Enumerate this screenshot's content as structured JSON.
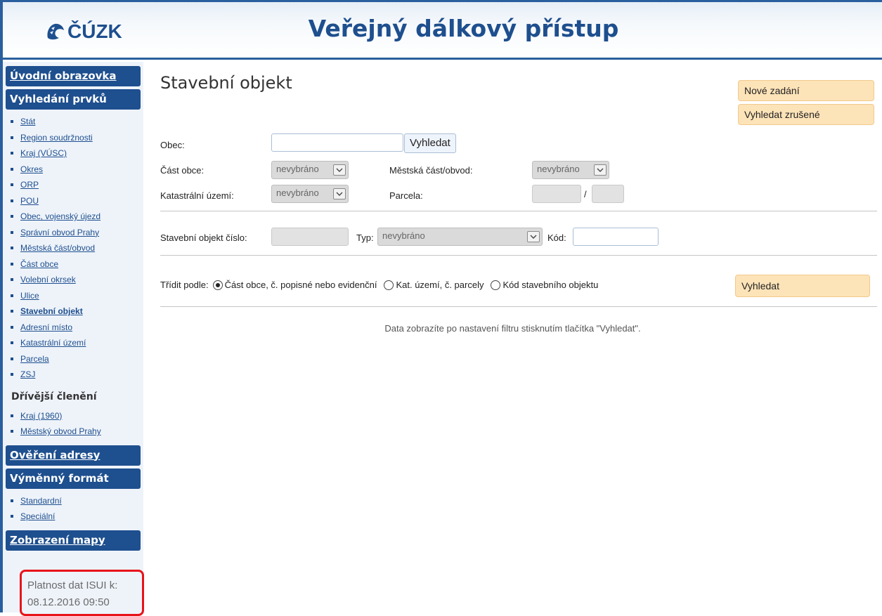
{
  "header": {
    "logo_text": "ČÚZK",
    "title": "Veřejný dálkový přístup"
  },
  "sidebar": {
    "home": "Úvodní obrazovka",
    "search_head": "Vyhledání prvků",
    "search_items": [
      {
        "label": "Stát"
      },
      {
        "label": "Region soudržnosti"
      },
      {
        "label": "Kraj (VÚSC)"
      },
      {
        "label": "Okres"
      },
      {
        "label": "ORP"
      },
      {
        "label": "POU"
      },
      {
        "label": "Obec, vojenský újezd"
      },
      {
        "label": "Správní obvod Prahy"
      },
      {
        "label": "Městská část/obvod"
      },
      {
        "label": "Část obce"
      },
      {
        "label": "Volební okrsek"
      },
      {
        "label": "Ulice"
      },
      {
        "label": "Stavební objekt"
      },
      {
        "label": "Adresní místo"
      },
      {
        "label": "Katastrální území"
      },
      {
        "label": "Parcela"
      },
      {
        "label": "ZSJ"
      }
    ],
    "former_label": "Dřívější členění",
    "former_items": [
      {
        "label": "Kraj (1960)"
      },
      {
        "label": "Městský obvod Prahy"
      }
    ],
    "verify_head": "Ověření adresy",
    "exchange_head": "Výměnný formát",
    "exchange_items": [
      {
        "label": "Standardní"
      },
      {
        "label": "Speciální"
      }
    ],
    "map_head": "Zobrazení mapy",
    "validity_label": "Platnost dat ISUI k:",
    "validity_value": "08.12.2016 09:50"
  },
  "main": {
    "title": "Stavební objekt",
    "new_entry_button": "Nové zadání",
    "search_cancelled_button": "Vyhledat zrušené",
    "obec_label": "Obec:",
    "obec_value": "",
    "obec_search_button": "Vyhledat",
    "cast_obce_label": "Část obce:",
    "cast_obce_value": "nevybráno",
    "mestska_cast_label": "Městská část/obvod:",
    "mestska_cast_value": "nevybráno",
    "kat_uzemi_label": "Katastrální území:",
    "kat_uzemi_value": "nevybráno",
    "parcela_label": "Parcela:",
    "parcela_separator": "/",
    "so_cislo_label": "Stavební objekt číslo:",
    "typ_label": "Typ:",
    "typ_value": "nevybráno",
    "kod_label": "Kód:",
    "sort_label": "Třídit podle:",
    "sort_options": [
      {
        "label": "Část obce, č. popisné nebo evidenční",
        "checked": true
      },
      {
        "label": "Kat. území, č. parcely",
        "checked": false
      },
      {
        "label": "Kód stavebního objektu",
        "checked": false
      }
    ],
    "search_button": "Vyhledat",
    "info_text": "Data zobrazíte po nastavení filtru stisknutím tlačítka \"Vyhledat\"."
  },
  "colors": {
    "brand_blue": "#1e4f8e",
    "orange_button": "#fde3b8",
    "highlight_red": "#e8131a"
  }
}
